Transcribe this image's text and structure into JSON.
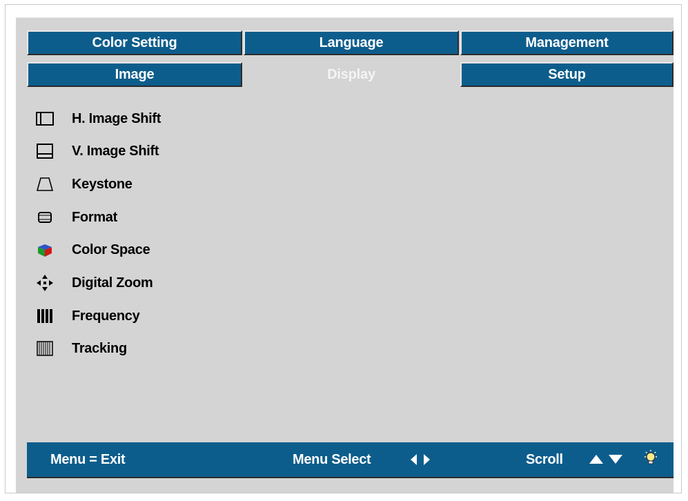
{
  "tabs": {
    "row1": [
      "Color Setting",
      "Language",
      "Management"
    ],
    "row2": [
      "Image",
      "Display",
      "Setup"
    ],
    "active": "Display"
  },
  "menu": {
    "items": [
      {
        "label": "H. Image Shift",
        "icon": "h-image-shift-icon"
      },
      {
        "label": "V. Image Shift",
        "icon": "v-image-shift-icon"
      },
      {
        "label": "Keystone",
        "icon": "keystone-icon"
      },
      {
        "label": "Format",
        "icon": "format-icon"
      },
      {
        "label": "Color Space",
        "icon": "color-space-icon"
      },
      {
        "label": "Digital Zoom",
        "icon": "digital-zoom-icon"
      },
      {
        "label": "Frequency",
        "icon": "frequency-icon"
      },
      {
        "label": "Tracking",
        "icon": "tracking-icon"
      }
    ]
  },
  "footer": {
    "exit_hint": "Menu = Exit",
    "select_hint": "Menu Select",
    "scroll_hint": "Scroll"
  },
  "colors": {
    "tab_blue": "#0d5d8c",
    "panel_gray": "#d4d4d4",
    "active_text": "#f4f4f4"
  }
}
